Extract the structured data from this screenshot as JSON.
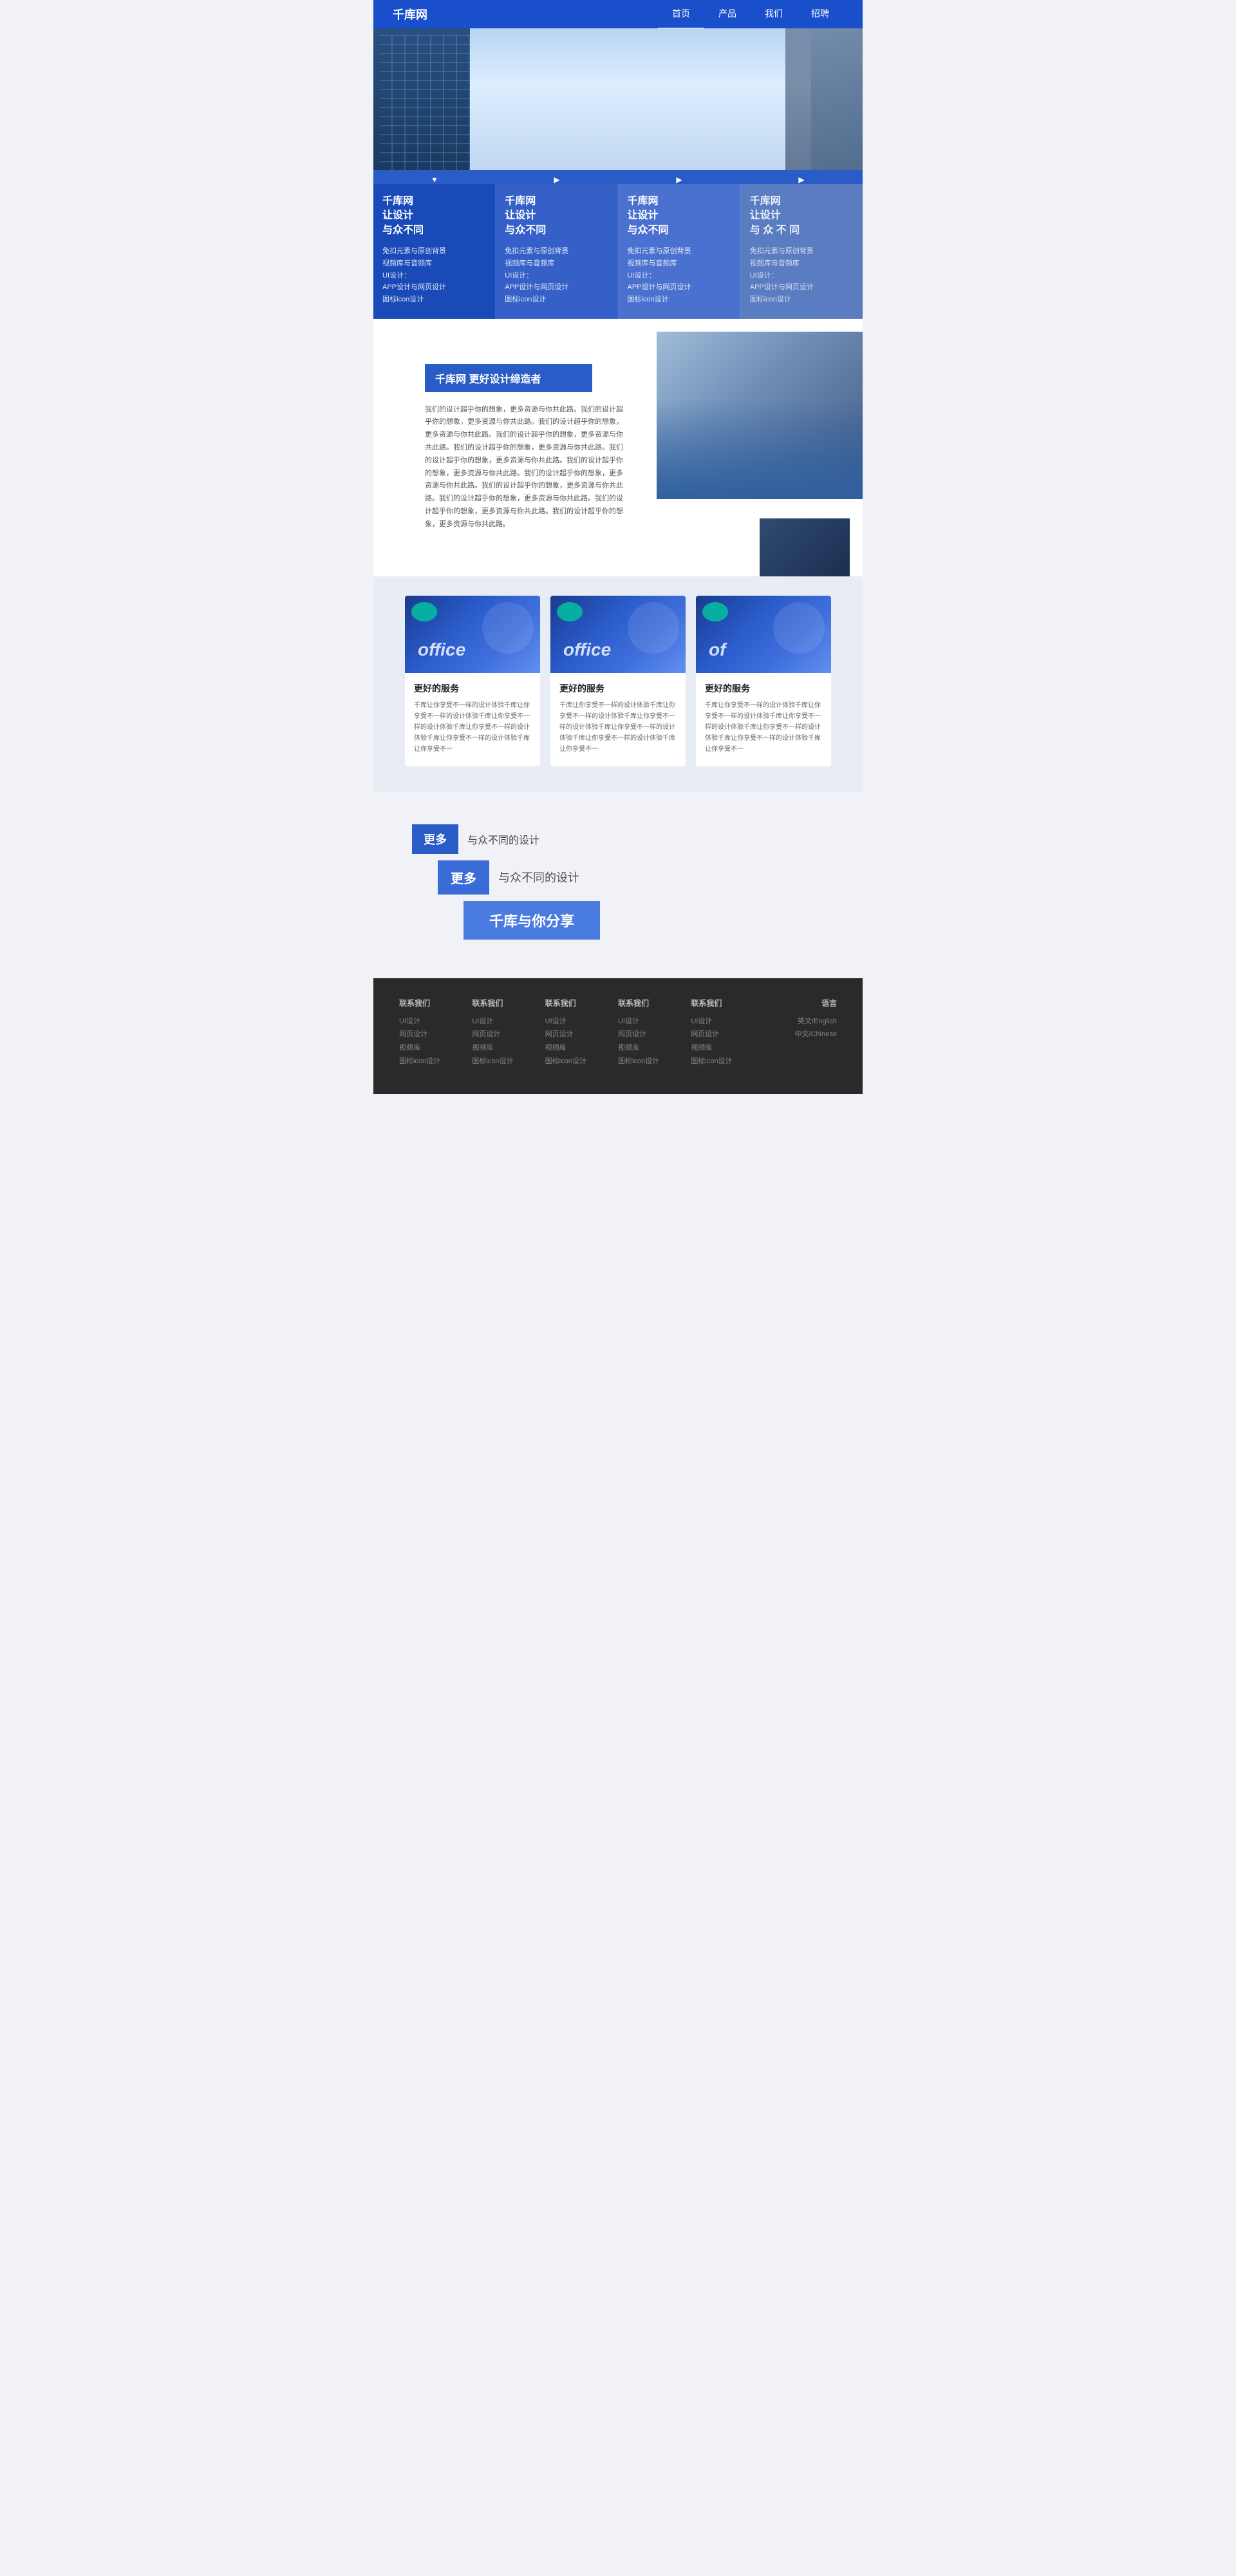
{
  "nav": {
    "logo": "千库网",
    "links": [
      {
        "label": "首页",
        "active": true
      },
      {
        "label": "产品",
        "active": false
      },
      {
        "label": "我们",
        "active": false
      },
      {
        "label": "招聘",
        "active": false
      }
    ]
  },
  "features": {
    "arrows": [
      "▼",
      "▶",
      "▶",
      "▶"
    ],
    "cards": [
      {
        "title": "千库网\n让设计\n与众不同",
        "desc": "免扣元素与原创背景\n视频库与音频库\nUI设计：\nAPP设计与网页设计\n图标icon设计"
      },
      {
        "title": "千库网\n让设计\n与众不同",
        "desc": "免扣元素与原创背景\n视频库与音频库\nUI设计：\nAPP设计与网页设计\n图标icon设计"
      },
      {
        "title": "千库网\n让设计\n与众不同",
        "desc": "免扣元素与原创背景\n视频库与音频库\nUI设计：\nAPP设计与网页设计\n图标icon设计"
      },
      {
        "title": "千库网\n让设计\n与 众 不 同",
        "desc": "免扣元素与原创背景\n视频库与音频库\nUI设计：\nAPP设计与网页设计\n图标icon设计"
      }
    ]
  },
  "about": {
    "title": "千库网  更好设计缔造者",
    "body": "我们的设计超乎你的想象，更多资源与你共此路。我们的设计超乎你的想象，更多资源与你共此路。我们的设计超乎你的想象，更多资源与你共此路。我们的设计超乎你的想象，更多资源与你共此路。我们的设计超乎你的想象，更多资源与你共此路。我们的设计超乎你的想象，更多资源与你共此路。我们的设计超乎你的想象，更多资源与你共此路。我们的设计超乎你的想象，更多资源与你共此路。我们的设计超乎你的想象，更多资源与你共此路。我们的设计超乎你的想象，更多资源与你共此路。我们的设计超乎你的想象，更多资源与你共此路。我们的设计超乎你的想象，更多资源与你共此路。"
  },
  "services": {
    "cards": [
      {
        "office_label": "office",
        "title": "更好的服务",
        "desc": "千库让你享受不一样的设计体验千库让你享受不一样的设计体验千库让你享受不一样的设计体验千库让你享受不一样的设计体验千库让你享受不一样的设计体验千库让你享受不一"
      },
      {
        "office_label": "office",
        "title": "更好的服务",
        "desc": "千库让你享受不一样的设计体验千库让你享受不一样的设计体验千库让你享受不一样的设计体验千库让你享受不一样的设计体验千库让你享受不一样的设计体验千库让你享受不一"
      },
      {
        "office_label": "of",
        "title": "更好的服务",
        "desc": "千库让你享受不一样的设计体验千库让你享受不一样的设计体验千库让你享受不一样的设计体验千库让你享受不一样的设计体验千库让你享受不一样的设计体验千库让你享受不一"
      }
    ]
  },
  "promo": {
    "row1_label": "更多",
    "row1_text": "与众不同的设计",
    "row2_label": "更多",
    "row2_text": "与众不同的设计",
    "row3_label": "千库与你分享"
  },
  "footer": {
    "cols": [
      {
        "title": "联系我们",
        "links": [
          "UI设计",
          "网页设计",
          "视频库",
          "图标icon设计"
        ]
      },
      {
        "title": "联系我们",
        "links": [
          "UI设计",
          "网页设计",
          "视频库",
          "图标icon设计"
        ]
      },
      {
        "title": "联系我们",
        "links": [
          "UI设计",
          "网页设计",
          "视频库",
          "图标icon设计"
        ]
      },
      {
        "title": "联系我们",
        "links": [
          "UI设计",
          "网页设计",
          "视频库",
          "图标icon设计"
        ]
      },
      {
        "title": "联系我们",
        "links": [
          "UI设计",
          "网页设计",
          "视频库",
          "图标icon设计"
        ]
      }
    ],
    "lang_title": "语言",
    "lang_options": [
      "英文/English",
      "中文/Chinese"
    ]
  }
}
